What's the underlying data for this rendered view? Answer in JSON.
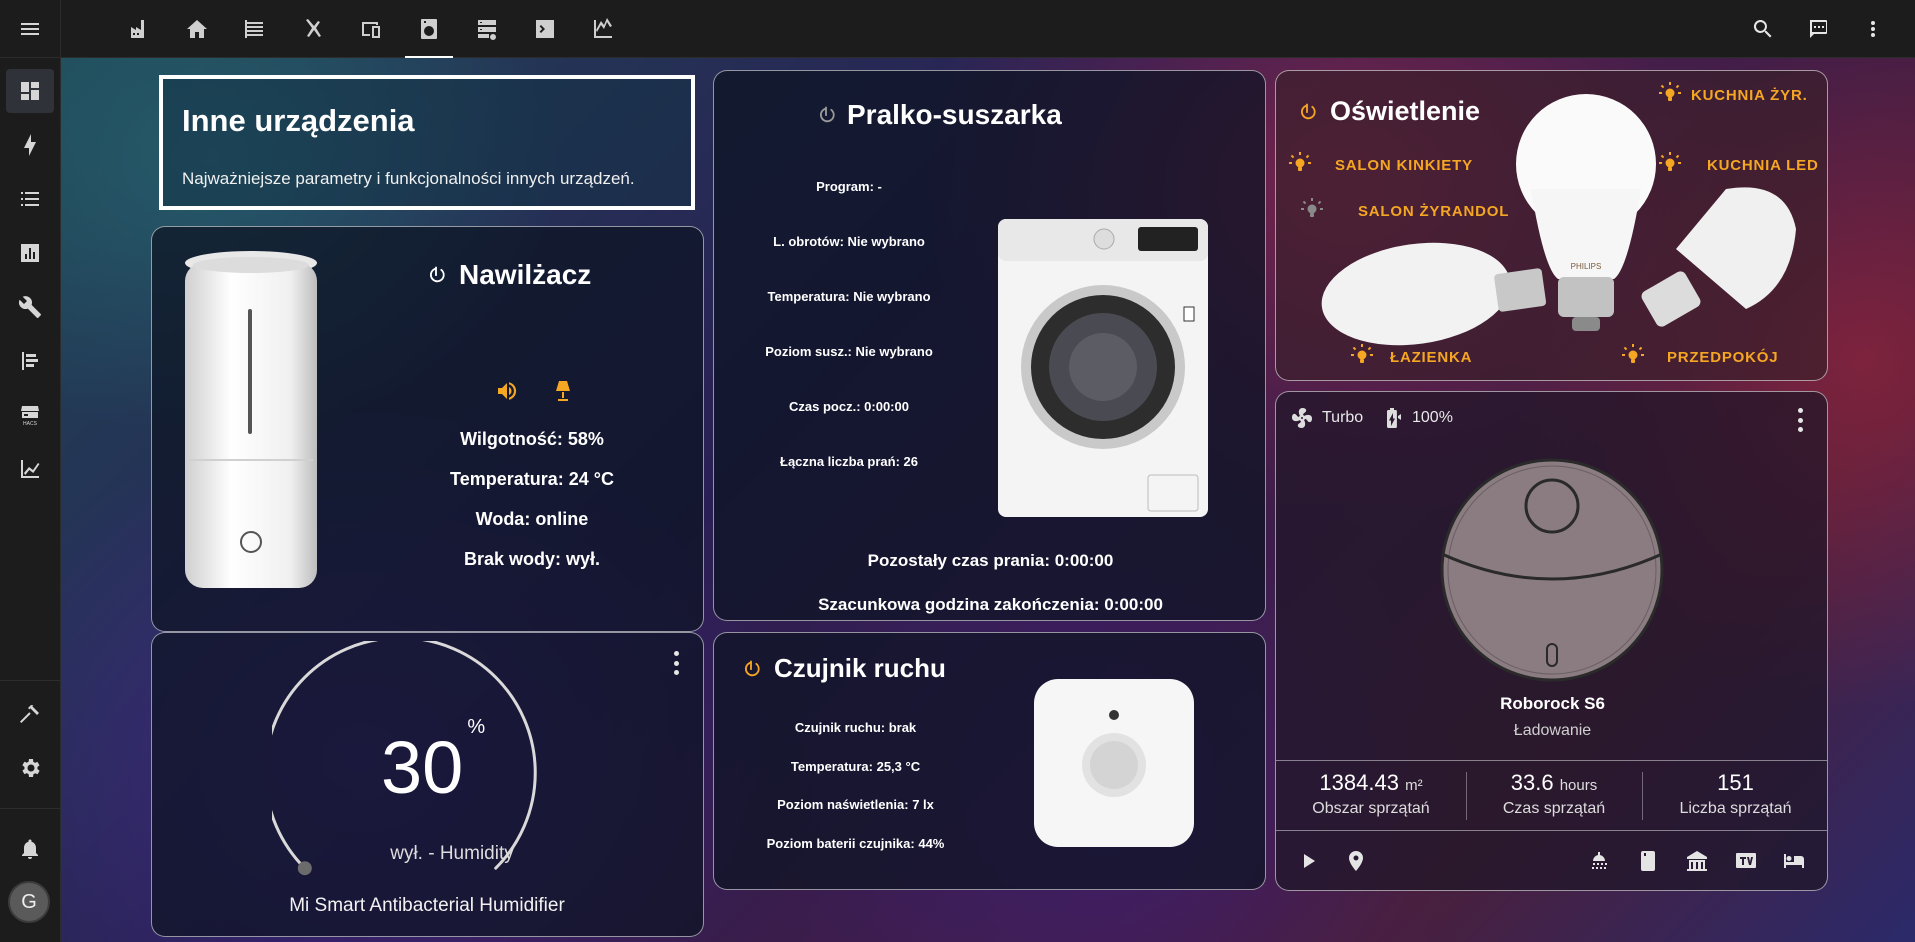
{
  "colors": {
    "accent": "#f5a623",
    "card_border": "#ffffff",
    "sidebar_bg": "#1c1c1c"
  },
  "topbar": {
    "tabs": [
      "factory-icon",
      "home-icon",
      "layers-icon",
      "vacuum-arm-icon",
      "devices-icon",
      "washing-machine-icon",
      "server-icon",
      "terminal-icon",
      "chart-icon"
    ],
    "active_tab": "washing-machine-icon",
    "actions": [
      "search-icon",
      "assist-icon",
      "more-vert-icon"
    ]
  },
  "sidebar": {
    "items": [
      "dashboard-icon",
      "energy-icon",
      "logbook-icon",
      "history-icon",
      "tools-icon",
      "todo-icon",
      "hacs-icon",
      "statistics-icon"
    ],
    "bottom": [
      "developer-tools-icon",
      "settings-icon",
      "notifications-icon"
    ],
    "user_initial": "G"
  },
  "header_card": {
    "title": "Inne urządzenia",
    "subtitle": "Najważniejsze parametry i funkcjonalności innych urządzeń."
  },
  "humidifier": {
    "title": "Nawilżacz",
    "humidity": "Wilgotność: 58%",
    "temperature": "Temperatura: 24 °C",
    "water": "Woda: online",
    "no_water": "Brak wody: wył."
  },
  "humidity_gauge": {
    "value": "30",
    "unit": "%",
    "state": "wył. - Humidity",
    "name": "Mi Smart Antibacterial Humidifier",
    "level": 0.3
  },
  "washer": {
    "title": "Pralko-suszarka",
    "program": "Program: -",
    "spin": "L. obrotów: Nie wybrano",
    "temperature": "Temperatura: Nie wybrano",
    "dry_level": "Poziom susz.: Nie wybrano",
    "start_time": "Czas pocz.: 0:00:00",
    "wash_count": "Łączna liczba prań: 26",
    "remaining": "Pozostały czas prania: 0:00:00",
    "estimated_end": "Szacunkowa godzina zakończenia: 0:00:00"
  },
  "motion": {
    "title": "Czujnik ruchu",
    "motion": "Czujnik ruchu: brak",
    "temperature": "Temperatura: 25,3 °C",
    "illuminance": "Poziom naświetlenia: 7 lx",
    "battery": "Poziom baterii czujnika: 44%"
  },
  "lighting": {
    "title": "Oświetlenie",
    "lights": [
      {
        "label": "KUCHNIA ŻYR.",
        "on": true
      },
      {
        "label": "SALON KINKIETY",
        "on": true
      },
      {
        "label": "KUCHNIA LED",
        "on": true
      },
      {
        "label": "SALON ŻYRANDOL",
        "on": false
      },
      {
        "label": "ŁAZIENKA",
        "on": true
      },
      {
        "label": "PRZEDPOKÓJ",
        "on": true
      }
    ],
    "bulb_brand": "PHILIPS"
  },
  "vacuum": {
    "fan_mode": "Turbo",
    "battery": "100%",
    "name": "Roborock S6",
    "status": "Ładowanie",
    "stats": [
      {
        "value": "1384.43",
        "unit": "m²",
        "label": "Obszar sprzątań"
      },
      {
        "value": "33.6",
        "unit": "hours",
        "label": "Czas sprzątań"
      },
      {
        "value": "151",
        "unit": "",
        "label": "Liczba sprzątań"
      }
    ],
    "controls": [
      "play-icon",
      "locate-icon"
    ],
    "rooms": [
      "bathroom-icon",
      "kitchen-icon",
      "hall-icon",
      "tv-icon",
      "bedroom-icon"
    ]
  }
}
